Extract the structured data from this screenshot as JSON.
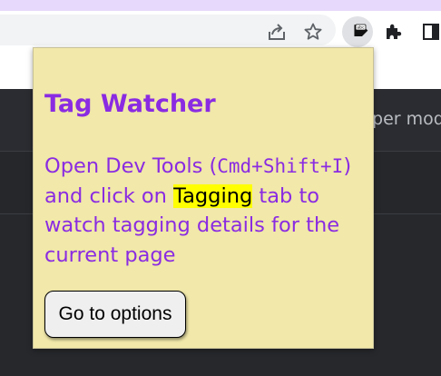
{
  "browser": {
    "toolbar": {
      "icons": [
        "share-icon",
        "star-icon",
        "tag-extension-icon",
        "puzzle-icon",
        "side-panel-icon"
      ],
      "extension_badge": "abc"
    }
  },
  "page": {
    "partial_text": "pper mod"
  },
  "popup": {
    "title": "Tag Watcher",
    "body_intro": "Open Dev Tools (",
    "shortcut": "Cmd+Shift+I",
    "body_mid": ") and click on ",
    "tab_name": "Tagging",
    "body_end": " tab to watch tagging details for the current page",
    "button_label": "Go to options"
  },
  "colors": {
    "popup_background": "#f1e8a9",
    "accent_purple": "#8a2be2",
    "highlight_yellow": "#ffff00",
    "page_dark": "#26282c"
  }
}
